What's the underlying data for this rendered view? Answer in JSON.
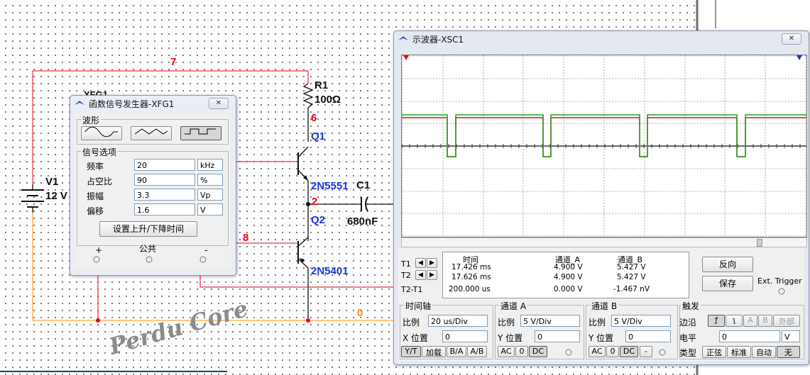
{
  "circuit": {
    "nodes": {
      "n7": "7",
      "n6": "6",
      "n2": "2",
      "n8": "8",
      "n0": "0"
    },
    "battery": {
      "name": "V1",
      "value": "12 V"
    },
    "resistor": {
      "name": "R1",
      "value": "100Ω"
    },
    "q1": {
      "name": "Q1",
      "model": "2N5551"
    },
    "q2": {
      "name": "Q2",
      "model": "2N5401"
    },
    "cap": {
      "name": "C1",
      "value": "680nF"
    },
    "xfg_label": "XFG1"
  },
  "fg": {
    "title": "函数信号发生器-XFG1",
    "close": "✕",
    "waveform_group": "波形",
    "signal_group": "信号选项",
    "rows": [
      {
        "label": "频率",
        "value": "20",
        "unit": "kHz"
      },
      {
        "label": "占空比",
        "value": "90",
        "unit": "%"
      },
      {
        "label": "振幅",
        "value": "3.3",
        "unit": "Vp"
      },
      {
        "label": "偏移",
        "value": "1.6",
        "unit": "V"
      }
    ],
    "rise_fall_button": "设置上升/下降时间",
    "term_plus": "+",
    "term_common": "公共",
    "term_minus": "-",
    "selected_waveform": "square"
  },
  "scope": {
    "title": "示波器-XSC1",
    "close": "✕",
    "readout": {
      "headers": [
        "时间",
        "通道_A",
        "通道_B"
      ],
      "rows": [
        {
          "label": "T1",
          "time": "17.426 ms",
          "a": "4.900 V",
          "b": "5.427 V"
        },
        {
          "label": "T2",
          "time": "17.626 ms",
          "a": "4.900 V",
          "b": "5.427 V"
        },
        {
          "label": "T2-T1",
          "time": "200.000 us",
          "a": "0.000 V",
          "b": "-1.467 nV"
        }
      ]
    },
    "reverse_button": "反向",
    "save_button": "保存",
    "ext_trigger": "Ext. Trigger",
    "timebase": {
      "title": "时间轴",
      "scale_label": "比例",
      "scale_value": "20 us/Div",
      "pos_label": "X 位置",
      "pos_value": "0",
      "modes": [
        "Y/T",
        "加载",
        "B/A",
        "A/B"
      ]
    },
    "channel_a": {
      "title": "通道 A",
      "scale_label": "比例",
      "scale_value": "5  V/Div",
      "pos_label": "Y 位置",
      "pos_value": "0",
      "coupling": [
        "AC",
        "0",
        "DC"
      ]
    },
    "channel_b": {
      "title": "通道 B",
      "scale_label": "比例",
      "scale_value": "5  V/Div",
      "pos_label": "Y 位置",
      "pos_value": "0",
      "coupling": [
        "AC",
        "0",
        "DC",
        "-"
      ]
    },
    "trigger": {
      "title": "触发",
      "edge_label": "边沿",
      "edge_buttons": [
        "ƒ",
        "ʅ",
        "A",
        "B",
        "外部"
      ],
      "level_label": "电平",
      "level_value": "0",
      "level_unit": "V",
      "type_label": "类型",
      "types": [
        "正弦",
        "标准",
        "自动",
        "无"
      ]
    },
    "colors": {
      "channel_a": "#e0140a",
      "channel_b": "#1fa01f",
      "trace_bg": "#ffffff"
    }
  },
  "watermark": "Perdu Core"
}
